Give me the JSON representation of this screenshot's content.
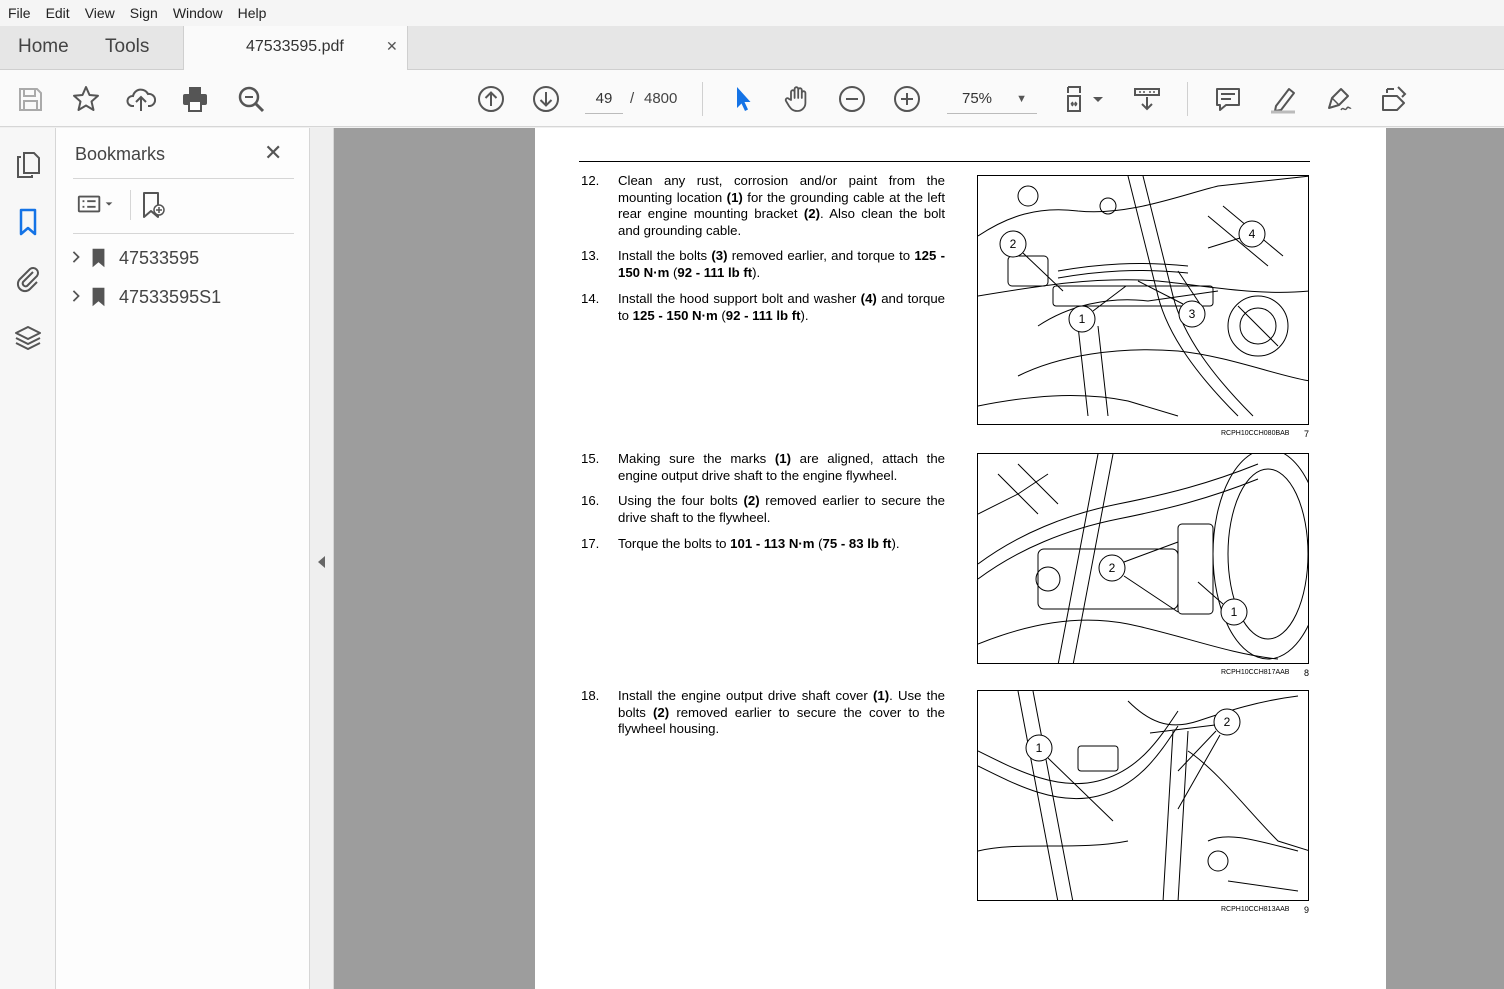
{
  "menu": [
    "File",
    "Edit",
    "View",
    "Sign",
    "Window",
    "Help"
  ],
  "tabs": {
    "home": "Home",
    "tools": "Tools",
    "doc_name": "47533595.pdf",
    "close": "✕"
  },
  "toolbar": {
    "page_current": "49",
    "page_sep": "/",
    "page_total": "4800",
    "zoom": "75%"
  },
  "bookmarks": {
    "title": "Bookmarks",
    "close": "✕",
    "items": [
      {
        "label": "47533595"
      },
      {
        "label": "47533595S1"
      }
    ]
  },
  "document": {
    "steps": [
      {
        "num": "12.",
        "html": "Clean any rust, corrosion and/or paint from the mounting location <b>(1)</b> for the grounding cable at the left rear engine mounting bracket <b>(2)</b>. Also clean the bolt and grounding cable."
      },
      {
        "num": "13.",
        "html": "Install the bolts <b>(3)</b> removed earlier, and torque to <b>125 - 150 N·m</b> (<b>92 - 111 lb ft</b>)."
      },
      {
        "num": "14.",
        "html": "Install the hood support bolt and washer <b>(4)</b> and torque to <b>125 - 150 N·m</b> (<b>92 - 111 lb ft</b>)."
      },
      {
        "num": "15.",
        "html": "Making sure the marks <b>(1)</b> are aligned, attach the engine output drive shaft to the engine flywheel."
      },
      {
        "num": "16.",
        "html": "Using the four bolts <b>(2)</b> removed earlier to secure the drive shaft to the flywheel."
      },
      {
        "num": "17.",
        "html": "Torque the bolts to <b>101 - 113 N·m</b> (<b>75 - 83 lb ft</b>)."
      },
      {
        "num": "18.",
        "html": "Install the engine output drive shaft cover <b>(1)</b>. Use the bolts <b>(2)</b> removed earlier to secure the cover to the flywheel housing."
      }
    ],
    "figures": [
      {
        "code": "RCPH10CCH080BAB",
        "number": "7",
        "callouts": [
          "1",
          "2",
          "3",
          "4"
        ]
      },
      {
        "code": "RCPH10CCH817AAB",
        "number": "8",
        "callouts": [
          "1",
          "2"
        ]
      },
      {
        "code": "RCPH10CCH813AAB",
        "number": "9",
        "callouts": [
          "1",
          "2"
        ]
      }
    ]
  }
}
